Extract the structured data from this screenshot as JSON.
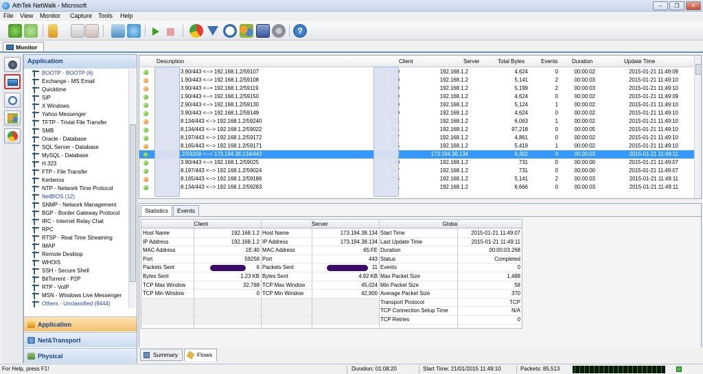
{
  "window": {
    "title": "AthTek NetWalk - Microsoft"
  },
  "menu": [
    "File",
    "View",
    "Monitor",
    "Capture",
    "Tools",
    "Help"
  ],
  "toolbar_icons": [
    "back-icon",
    "forward-icon",
    "folder-icon",
    "save-icon",
    "export-icon",
    "capture-icon",
    "refresh-icon",
    "play-icon",
    "stop-icon",
    "pie-chart-icon",
    "filter-icon",
    "clock-icon",
    "users-icon",
    "report-icon",
    "settings-icon",
    "help-icon"
  ],
  "monitor_tab": "Monitor",
  "left_panel": {
    "header": "Application",
    "items": [
      {
        "label": "BOOTP - BOOTP (6)",
        "blue": true
      },
      {
        "label": "Exchange - MS Email",
        "blue": false
      },
      {
        "label": "Quicktime",
        "blue": false
      },
      {
        "label": "SIP",
        "blue": false
      },
      {
        "label": "X Windows",
        "blue": false
      },
      {
        "label": "Yahoo Messenger",
        "blue": false
      },
      {
        "label": "TFTP - Trivial File Transfer",
        "blue": false
      },
      {
        "label": "SMB",
        "blue": false
      },
      {
        "label": "Oracle - Database",
        "blue": false
      },
      {
        "label": "SQL Server - Database",
        "blue": false
      },
      {
        "label": "MySQL - Database",
        "blue": false
      },
      {
        "label": "H.323",
        "blue": false
      },
      {
        "label": "FTP - File Transfer",
        "blue": false
      },
      {
        "label": "Kerberos",
        "blue": false
      },
      {
        "label": "NTP - Network Time Protocol",
        "blue": false
      },
      {
        "label": "NetBIOS (12)",
        "blue": true
      },
      {
        "label": "SNMP - Network Management",
        "blue": false
      },
      {
        "label": "BGP - Border Gateway Protocol",
        "blue": false
      },
      {
        "label": "IRC - Internet Relay Chat",
        "blue": false
      },
      {
        "label": "RPC",
        "blue": false
      },
      {
        "label": "RTSP - Real Time Streaming",
        "blue": false
      },
      {
        "label": "IMAP",
        "blue": false
      },
      {
        "label": "Remote Desktop",
        "blue": false
      },
      {
        "label": "WHOIS",
        "blue": false
      },
      {
        "label": "SSH - Secure Shell",
        "blue": false
      },
      {
        "label": "BitTorrent - P2P",
        "blue": false
      },
      {
        "label": "RTP - VoIP",
        "blue": false
      },
      {
        "label": "MSN - Windows Live Messenger",
        "blue": false
      },
      {
        "label": "Others - Unclassified (9444)",
        "blue": true
      }
    ],
    "nav": [
      "Application",
      "Net&Transport",
      "Physical"
    ]
  },
  "grid": {
    "headers": [
      "Description",
      "Client",
      "Server",
      "Total Bytes",
      "Events",
      "Duration",
      "Update Time"
    ],
    "rows": [
      {
        "status": "green",
        "desc": "3.90/443 <--> 192.168.1.2/59107",
        "client": "3.90",
        "server": "192.168.1.2",
        "bytes": "4,624",
        "events": "0",
        "duration": "00:00:02",
        "update": "2015-01-21 11:49:09"
      },
      {
        "status": "orange",
        "desc": "1.90/443 <--> 192.168.1.2/59108",
        "client": "1.90",
        "server": "192.168.1.2",
        "bytes": "5,141",
        "events": "2",
        "duration": "00:00:03",
        "update": "2015-01-21 11:49:10"
      },
      {
        "status": "orange",
        "desc": "3.90/443 <--> 192.168.1.2/59119",
        "client": "3.90",
        "server": "192.168.1.2",
        "bytes": "5,199",
        "events": "2",
        "duration": "00:00:03",
        "update": "2015-01-21 11:49:10"
      },
      {
        "status": "green",
        "desc": "1.90/443 <--> 192.168.1.2/59150",
        "client": "1.90",
        "server": "192.168.1.2",
        "bytes": "4,624",
        "events": "0",
        "duration": "00:00:02",
        "update": "2015-01-21 11:49:09"
      },
      {
        "status": "green",
        "desc": "2.90/443 <--> 192.168.1.2/59130",
        "client": "2.90",
        "server": "192.168.1.2",
        "bytes": "5,124",
        "events": "1",
        "duration": "00:00:02",
        "update": "2015-01-21 11:49:10"
      },
      {
        "status": "green",
        "desc": "3.90/443 <--> 192.168.1.2/59149",
        "client": "3.90",
        "server": "192.168.1.2",
        "bytes": "4,624",
        "events": "0",
        "duration": "00:00:02",
        "update": "2015-01-21 11:49:10"
      },
      {
        "status": "orange",
        "desc": "8.134/443 <--> 192.168.1.2/59240",
        "client": ".134",
        "server": "192.168.1.2",
        "bytes": "6,063",
        "events": "1",
        "duration": "00:00:02",
        "update": "2015-01-21 11:49:10"
      },
      {
        "status": "green",
        "desc": "8.134/443 <--> 192.168.1.2/59022",
        "client": ".134",
        "server": "192.168.1.2",
        "bytes": "97,218",
        "events": "0",
        "duration": "00:00:05",
        "update": "2015-01-21 11:49:10"
      },
      {
        "status": "green",
        "desc": "8.197/443 <--> 192.168.1.2/59172",
        "client": ".197",
        "server": "192.168.1.2",
        "bytes": "4,861",
        "events": "0",
        "duration": "00:00:02",
        "update": "2015-01-21 11:49:10"
      },
      {
        "status": "orange",
        "desc": "8.165/443 <--> 192.168.1.2/59171",
        "client": ".165",
        "server": "192.168.1.2",
        "bytes": "5,419",
        "events": "1",
        "duration": "00:00:02",
        "update": "2015-01-21 11:49:10"
      },
      {
        "status": "green",
        "desc": ".2/59258 <--> 173.194.38.134/443",
        "client": "1.2",
        "server": "173.194.38.134",
        "bytes": "6,302",
        "events": "0",
        "duration": "00:00:03",
        "update": "2015-01-21 11:49:11",
        "selected": true
      },
      {
        "status": "green",
        "desc": "3.90/443 <--> 192.168.1.2/59025",
        "client": "3.90",
        "server": "192.168.1.2",
        "bytes": "731",
        "events": "0",
        "duration": "00:00:00",
        "update": "2015-01-21 11:49:07"
      },
      {
        "status": "green",
        "desc": "8.197/443 <--> 192.168.1.2/59024",
        "client": ".197",
        "server": "192.168.1.2",
        "bytes": "731",
        "events": "0",
        "duration": "00:00:00",
        "update": "2015-01-21 11:49:07"
      },
      {
        "status": "orange",
        "desc": "8.165/443 <--> 192.168.1.2/59186",
        "client": ".165",
        "server": "192.168.1.2",
        "bytes": "5,141",
        "events": "2",
        "duration": "00:00:03",
        "update": "2015-01-21 11:49:11"
      },
      {
        "status": "green",
        "desc": "8.134/443 <--> 192.168.1.2/59283",
        "client": ".134",
        "server": "192.168.1.2",
        "bytes": "6,666",
        "events": "0",
        "duration": "00:00:03",
        "update": "2015-01-21 11:49:11"
      }
    ]
  },
  "detail_tabs": [
    "Statistics",
    "Events"
  ],
  "stats": {
    "headers": [
      "Client",
      "Server",
      "Global"
    ],
    "client": [
      [
        "Host Name",
        "192.168.1.2"
      ],
      [
        "IP Address",
        "192.168.1.2"
      ],
      [
        "MAC Address",
        "1E:40"
      ],
      [
        "Port",
        "59258"
      ],
      [
        "Packets Sent",
        "6"
      ],
      [
        "Bytes Sent",
        "1.23 KB"
      ],
      [
        "TCP Max Window",
        "32,768"
      ],
      [
        "TCP Min Window",
        "0"
      ]
    ],
    "server": [
      [
        "Host Name",
        "173.194.38.134"
      ],
      [
        "IP Address",
        "173.194.38.134"
      ],
      [
        "MAC Address",
        "65:FE"
      ],
      [
        "Port",
        "443"
      ],
      [
        "Packets Sent",
        "11"
      ],
      [
        "Bytes Sent",
        "4.92 KB"
      ],
      [
        "TCP Max Window",
        "45,024"
      ],
      [
        "TCP Min Window",
        "42,900"
      ]
    ],
    "global": [
      [
        "Start Time",
        "2015-01-21 11:49:07"
      ],
      [
        "Last Update Time",
        "2015-01-21 11:49:11"
      ],
      [
        "Duration",
        "00:00:03.268"
      ],
      [
        "Status",
        "Completed"
      ],
      [
        "Events",
        "0"
      ],
      [
        "Max Packet Size",
        "1,488"
      ],
      [
        "Min Packet Size",
        "58"
      ],
      [
        "Average Packet Size",
        "370"
      ],
      [
        "Transport Protocol",
        "TCP"
      ],
      [
        "TCP Connection Setup Time",
        "N/A"
      ],
      [
        "TCP Retries",
        "0"
      ]
    ]
  },
  "bottom_tabs": [
    "Summary",
    "Flows"
  ],
  "status": {
    "help": "For Help, press F1!",
    "duration": "Duration: 01:08:20",
    "start": "Start Time: 21/01/2015 11:49:10",
    "packets": "Packets: 85,513"
  }
}
